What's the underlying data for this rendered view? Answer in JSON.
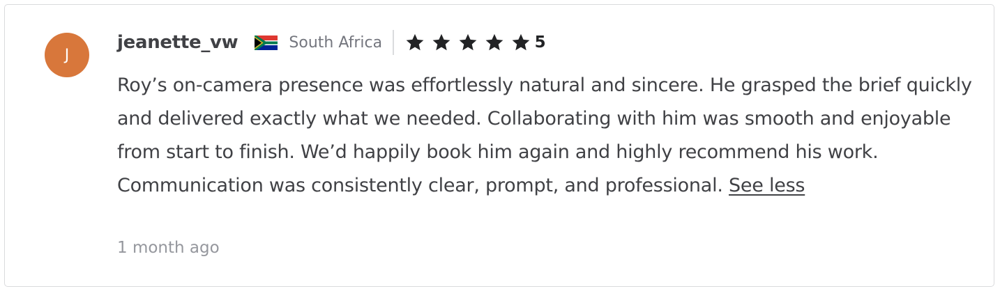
{
  "reviewer": {
    "avatar_initial": "J",
    "avatar_color": "#d8773b",
    "username": "jeanette_vw",
    "flag_icon": "south-africa-flag-icon",
    "country": "South Africa"
  },
  "rating": {
    "stars": 5,
    "max_stars": 5,
    "value": "5",
    "star_color": "#222325"
  },
  "review": {
    "text": "Roy’s on-camera presence was effortlessly natural and sincere. He grasped the brief quickly and delivered exactly what we needed. Collaborating with him was smooth and enjoyable from start to finish. We’d happily book him again and highly recommend his work. Communication was consistently clear, prompt, and professional.",
    "toggle_label": "See less",
    "time_ago": "1 month ago"
  }
}
